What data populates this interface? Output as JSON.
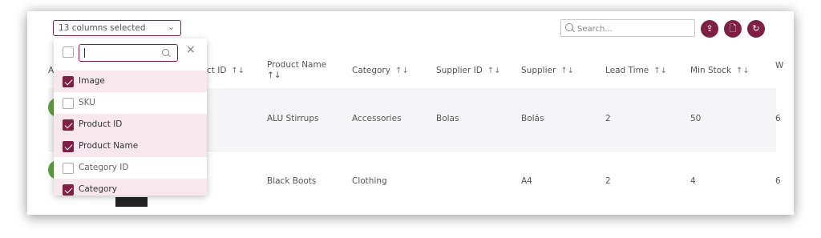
{
  "toolbar": {
    "column_selector": "13 columns selected",
    "search_placeholder": "Search...",
    "buttons": [
      {
        "name": "upload-button",
        "glyph": "⇪"
      },
      {
        "name": "document-button",
        "glyph": "🗋"
      },
      {
        "name": "refresh-button",
        "glyph": "↻"
      }
    ]
  },
  "table": {
    "headers": {
      "first": "A",
      "product_id": "ct ID",
      "product_name_1": "Product Name",
      "product_name_2": "↑↓",
      "category": "Category",
      "supplier_id": "Supplier ID",
      "supplier": "Supplier",
      "lead_time": "Lead Time",
      "min_stock": "Min Stock",
      "last": "W"
    },
    "sort_glyph": "↑↓",
    "rows": [
      {
        "product_name": "ALU Stirrups",
        "category": "Accessories",
        "supplier_id": "Bolas",
        "supplier": "Bolás",
        "lead_time": "2",
        "min_stock": "50",
        "last": "6"
      },
      {
        "product_name": "Black Boots",
        "category": "Clothing",
        "supplier_id": "",
        "supplier": "A4",
        "lead_time": "2",
        "min_stock": "4",
        "last": "6"
      }
    ]
  },
  "dropdown": {
    "filter_value": "",
    "close_glyph": "×",
    "items": [
      {
        "label": "Image",
        "checked": true
      },
      {
        "label": "SKU",
        "checked": false
      },
      {
        "label": "Product ID",
        "checked": true
      },
      {
        "label": "Product Name",
        "checked": true
      },
      {
        "label": "Category ID",
        "checked": false
      },
      {
        "label": "Category",
        "checked": true
      }
    ]
  },
  "colors": {
    "accent": "#7e1f44",
    "avatar": "#5e9e3e",
    "selected_row": "#f8e8ee"
  }
}
